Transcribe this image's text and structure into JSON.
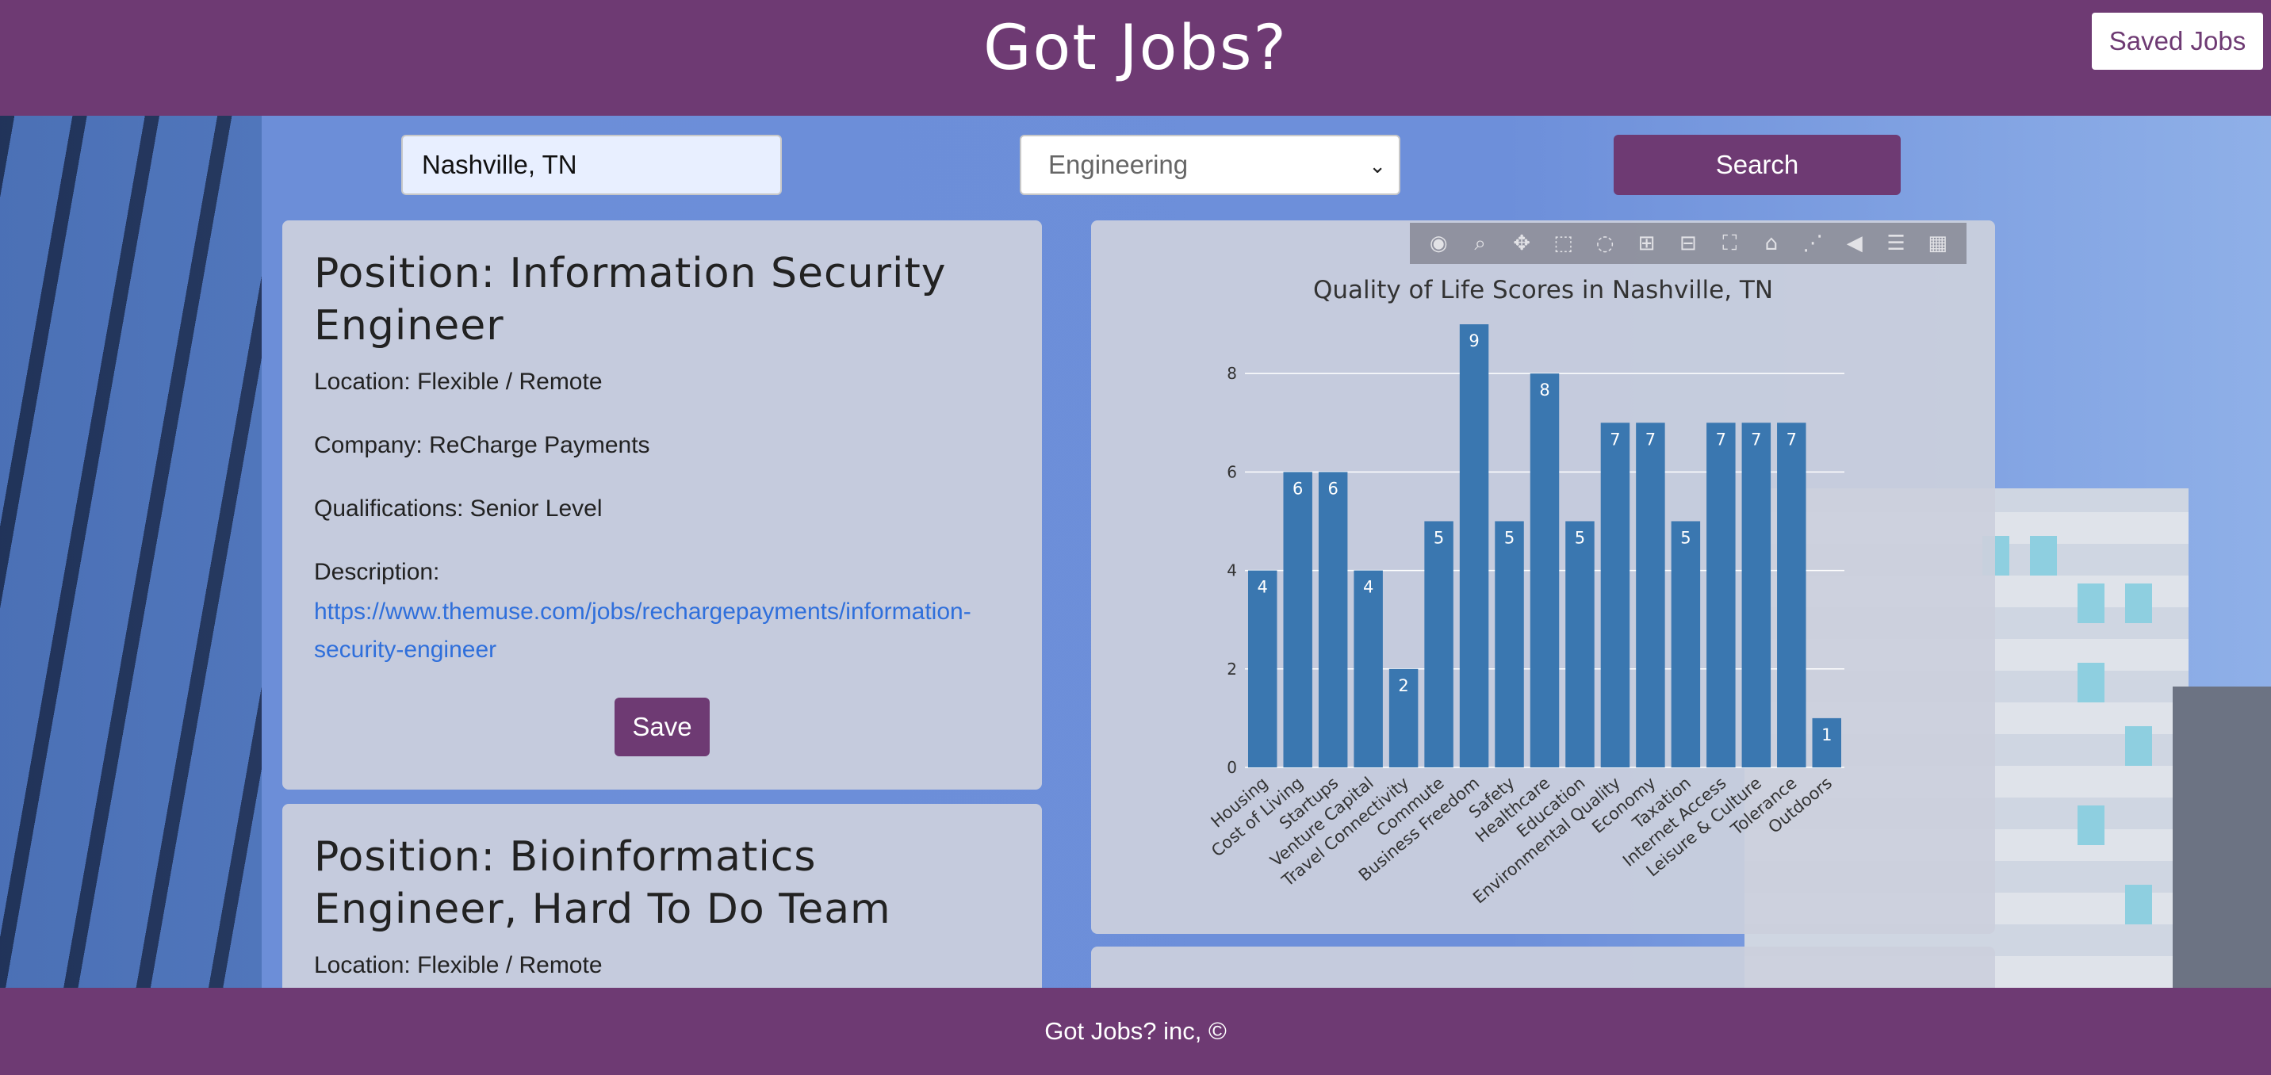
{
  "header": {
    "title": "Got Jobs?",
    "saved_jobs_label": "Saved Jobs"
  },
  "search": {
    "location_value": "Nashville, TN",
    "category_selected": "Engineering",
    "button_label": "Search"
  },
  "jobs": [
    {
      "title": "Position: Information Security Engineer",
      "location": "Location: Flexible / Remote",
      "company": "Company: ReCharge Payments",
      "qualifications": "Qualifications: Senior Level",
      "description_label": "Description:",
      "link": "https://www.themuse.com/jobs/rechargepayments/information-security-engineer",
      "save_label": "Save"
    },
    {
      "title": "Position: Bioinformatics Engineer, Hard To Do Team",
      "location": "Location: Flexible / Remote"
    }
  ],
  "modebar": {
    "icons": [
      "camera-icon",
      "zoom-icon",
      "pan-icon",
      "box-select-icon",
      "lasso-icon",
      "zoom-in-icon",
      "zoom-out-icon",
      "autoscale-icon",
      "reset-axes-icon",
      "spike-lines-icon",
      "hover-closest-icon",
      "hover-compare-icon",
      "plotly-logo-icon"
    ]
  },
  "chart_data": {
    "type": "bar",
    "title": "Quality of Life Scores in Nashville, TN",
    "categories": [
      "Housing",
      "Cost of Living",
      "Startups",
      "Venture Capital",
      "Travel Connectivity",
      "Commute",
      "Business Freedom",
      "Safety",
      "Healthcare",
      "Education",
      "Environmental Quality",
      "Economy",
      "Taxation",
      "Internet Access",
      "Leisure & Culture",
      "Tolerance",
      "Outdoors"
    ],
    "values": [
      4,
      6,
      6,
      4,
      2,
      5,
      9,
      5,
      8,
      5,
      7,
      7,
      5,
      7,
      7,
      7,
      1
    ],
    "data_labels": [
      "4",
      "6",
      "6",
      "4",
      "2",
      "5",
      "9",
      "5",
      "8",
      "5",
      "7",
      "7",
      "5",
      "7",
      "7",
      "7",
      "1"
    ],
    "yticks": [
      "0",
      "2",
      "4",
      "6",
      "8"
    ],
    "ylim": [
      0,
      9.5
    ],
    "bar_color": "#3a77b0",
    "grid": true
  },
  "footer": {
    "text": "Got Jobs? inc, ©"
  }
}
